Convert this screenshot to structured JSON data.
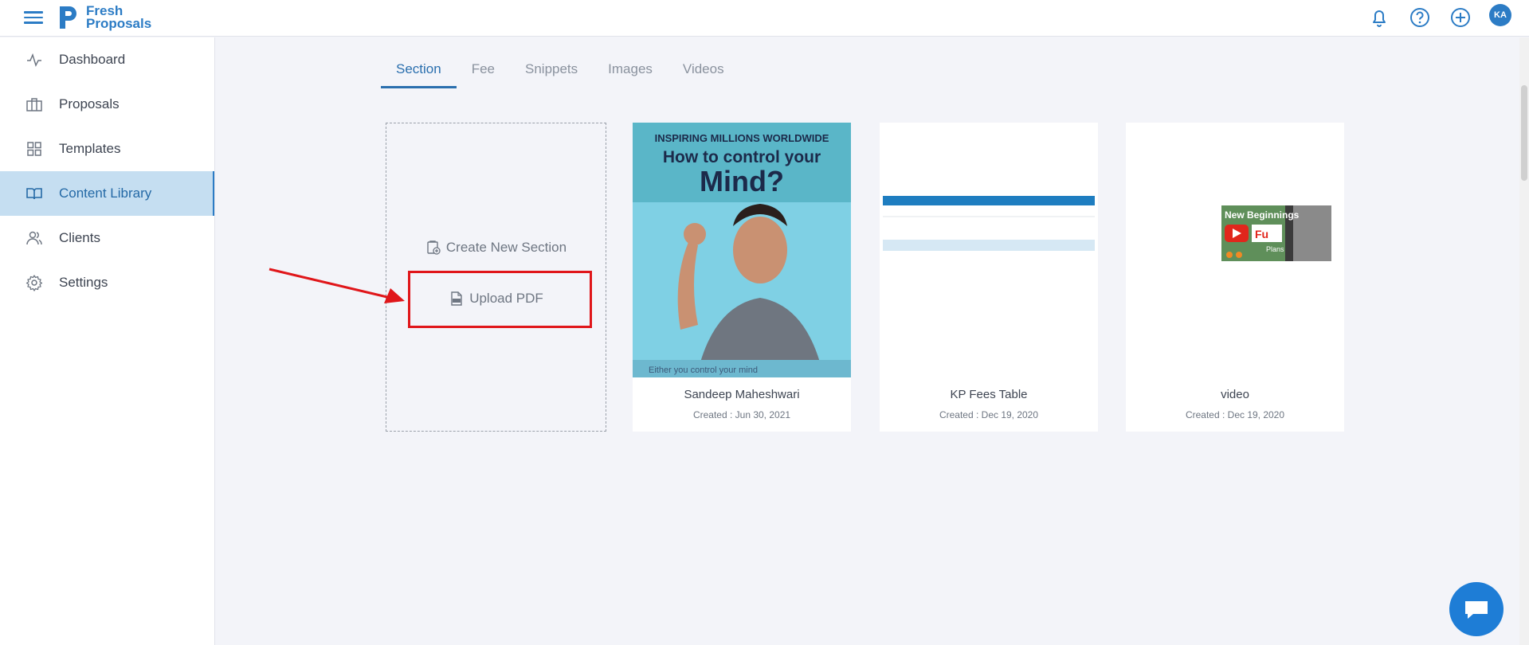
{
  "app": {
    "logo_line1": "Fresh",
    "logo_line2": "Proposals",
    "accent_color": "#2c7cc5"
  },
  "header": {
    "icons": [
      "bell-icon",
      "help-icon",
      "add-icon"
    ],
    "avatar_initials": "KA"
  },
  "sidebar": {
    "items": [
      {
        "label": "Dashboard",
        "icon": "activity-icon"
      },
      {
        "label": "Proposals",
        "icon": "briefcase-icon"
      },
      {
        "label": "Templates",
        "icon": "grid-icon"
      },
      {
        "label": "Content Library",
        "icon": "book-icon",
        "active": true
      },
      {
        "label": "Clients",
        "icon": "users-icon"
      },
      {
        "label": "Settings",
        "icon": "gear-icon"
      }
    ]
  },
  "tabs": [
    {
      "label": "Section",
      "active": true
    },
    {
      "label": "Fee"
    },
    {
      "label": "Snippets"
    },
    {
      "label": "Images"
    },
    {
      "label": "Videos"
    }
  ],
  "new_card": {
    "create_label": "Create New Section",
    "upload_label": "Upload PDF"
  },
  "cards": [
    {
      "name": "Sandeep Maheshwari",
      "date": "Created : Jun 30, 2021",
      "thumb": {
        "kicker": "INSPIRING MILLIONS WORLDWIDE",
        "headline": "How to control your",
        "headline2": "Mind?",
        "quote": "Either you control your mind"
      }
    },
    {
      "name": "KP Fees Table",
      "date": "Created : Dec 19, 2020"
    },
    {
      "name": "video",
      "date": "Created : Dec 19, 2020",
      "thumb": {
        "caption": "New Beginnings",
        "sub": "Fu",
        "sub2": "Plans"
      }
    }
  ]
}
